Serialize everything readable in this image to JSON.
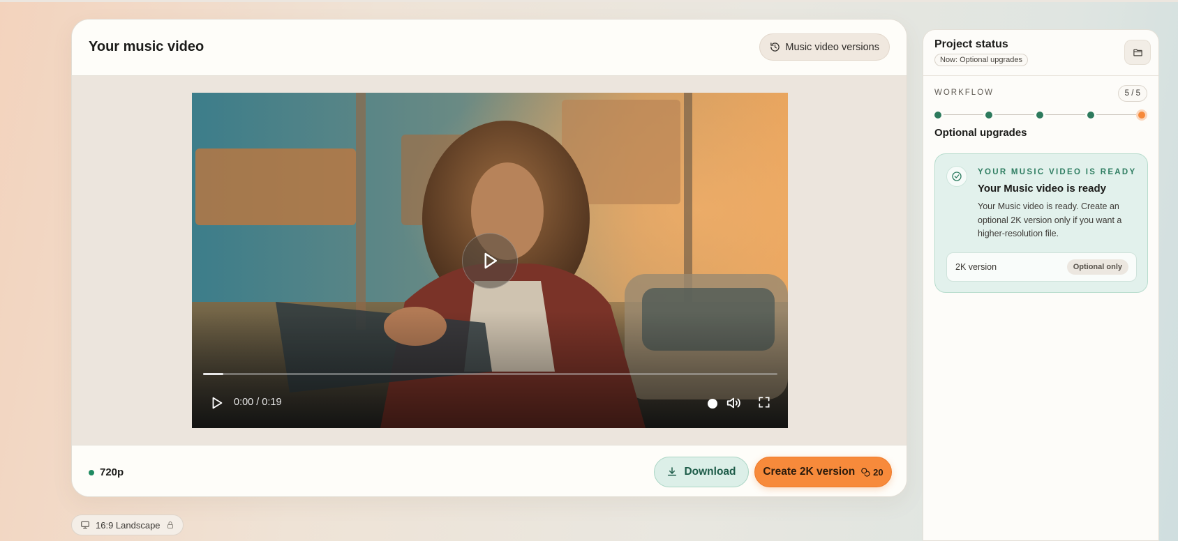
{
  "header": {
    "title": "Your music video",
    "versions_label": "Music video versions"
  },
  "player": {
    "time": "0:00 / 0:19",
    "progress": 0.035
  },
  "footer": {
    "resolution": "720p",
    "download_label": "Download",
    "create_label": "Create 2K version",
    "credits": "20"
  },
  "aspect": {
    "label": "16:9 Landscape"
  },
  "project": {
    "title": "Project status",
    "now": "Now: Optional upgrades",
    "workflow_label": "WORKFLOW",
    "workflow_count": "5 / 5",
    "current_step": "Optional upgrades",
    "steps_total": 5,
    "steps_done": 4
  },
  "ready": {
    "eyebrow": "YOUR MUSIC VIDEO IS READY",
    "title": "Your Music video is ready",
    "description": "Your Music video is ready. Create an optional 2K version only if you want a higher-resolution file.",
    "option_name": "2K version",
    "option_badge": "Optional only"
  },
  "colors": {
    "accent_orange": "#f78a3b",
    "accent_green": "#2d7a5d",
    "ready_bg": "#e2f1ec"
  },
  "icons": {
    "versions": "history-icon",
    "download": "download-icon",
    "credits": "coins-icon",
    "aspect": "monitor-icon",
    "lock": "lock-icon",
    "folder": "folder-icon",
    "ready": "check-circle-icon"
  }
}
